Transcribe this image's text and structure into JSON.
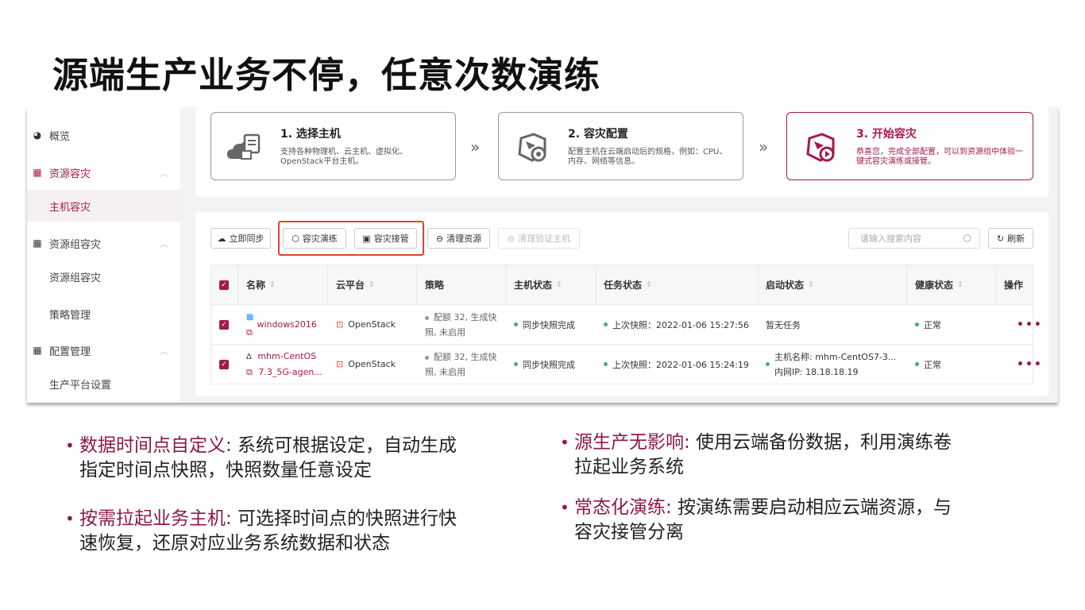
{
  "slide_title": "源端生产业务不停，任意次数演练",
  "sidebar": {
    "overview": "概览",
    "resource_dr": "资源容灾",
    "host_dr": "主机容灾",
    "group_dr": "资源组容灾",
    "group_dr_sub": "资源组容灾",
    "policy_mgmt": "策略管理",
    "config_mgmt": "配置管理",
    "platform_settings": "生产平台设置"
  },
  "steps": [
    {
      "title": "1. 选择主机",
      "desc": "支持各种物理机、云主机、虚拟化、OpenStack平台主机。"
    },
    {
      "title": "2. 容灾配置",
      "desc": "配置主机在云端启动后的规格，例如：CPU、内存、网络等信息。"
    },
    {
      "title": "3. 开始容灾",
      "desc": "恭喜您，完成全部配置，可以到资源组中体验一键式容灾演练或接管。"
    }
  ],
  "toolbar": {
    "sync": "立即同步",
    "drill": "容灾演练",
    "takeover": "容灾接管",
    "clean": "清理资源",
    "clean_verify": "清理验证主机",
    "search_placeholder": "请输入搜索内容",
    "refresh": "刷新"
  },
  "table": {
    "headers": [
      "名称",
      "云平台",
      "策略",
      "主机状态",
      "任务状态",
      "启动状态",
      "健康状态",
      "操作"
    ],
    "rows": [
      {
        "name": "windows2016",
        "platform": "OpenStack",
        "policy_1": "配额 32, 生成快",
        "policy_2": "照, 未启用",
        "host_status": "同步快照完成",
        "task_status": "上次快照：2022-01-06 15:27:56",
        "boot_status": "暂无任务",
        "health": "正常"
      },
      {
        "name_1": "mhm-CentOS",
        "name_2": "7.3_5G-agen...",
        "platform": "OpenStack",
        "policy_1": "配额 32, 生成快",
        "policy_2": "照, 未启用",
        "host_status": "同步快照完成",
        "task_status": "上次快照：2022-01-06 15:24:19",
        "boot_1": "主机名称: mhm-CentOS7-3...",
        "boot_2": "内网IP: 18.18.18.19",
        "health": "正常"
      }
    ]
  },
  "bullets": [
    {
      "key": "数据时间点自定义:",
      "line1": " 系统可根据设定，自动生成",
      "line2": "指定时间点快照，快照数量任意设定"
    },
    {
      "key": "按需拉起业务主机:",
      "line1": " 可选择时间点的快照进行快",
      "line2": "速恢复，还原对应业务系统数据和状态"
    },
    {
      "key": "源生产无影响:",
      "line1": " 使用云端备份数据，利用演练卷",
      "line2": "拉起业务系统"
    },
    {
      "key": "常态化演练:",
      "line1": " 按演练需要启动相应云端资源，与",
      "line2": "容灾接管分离"
    }
  ],
  "colors": {
    "accent": "#a3194d",
    "highlight_box": "#e0452b",
    "ok": "#3cb371"
  }
}
